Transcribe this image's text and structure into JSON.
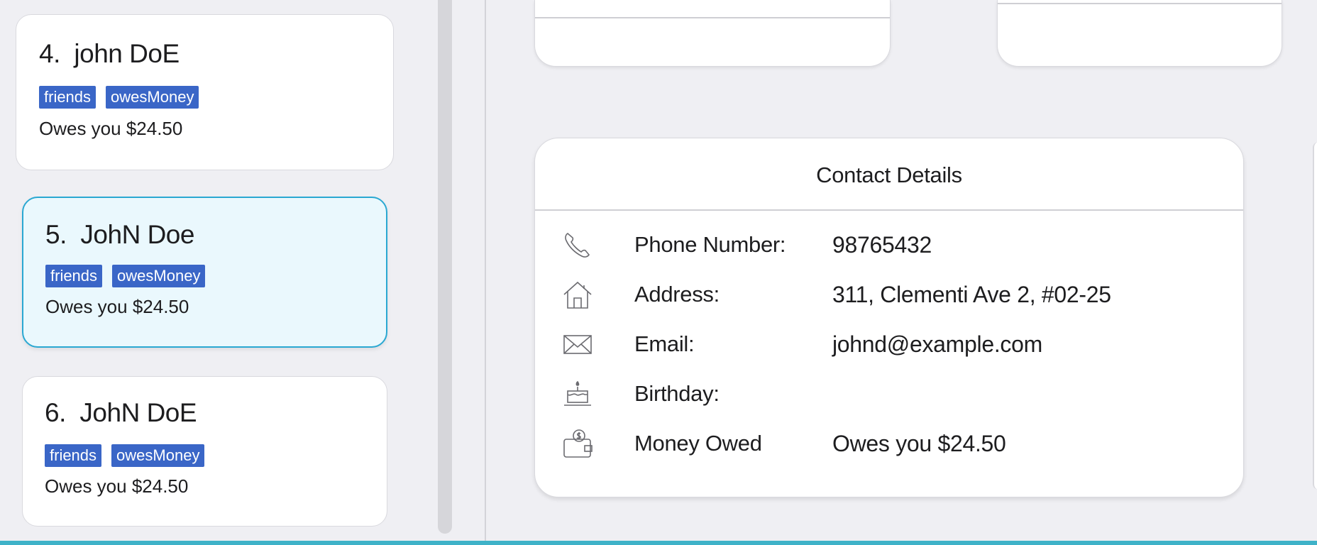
{
  "contacts": [
    {
      "index": "4.",
      "name": "john DoE",
      "tags": [
        "friends",
        "owesMoney"
      ],
      "owed": "Owes you $24.50"
    },
    {
      "index": "5.",
      "name": "JohN Doe",
      "tags": [
        "friends",
        "owesMoney"
      ],
      "owed": "Owes you $24.50"
    },
    {
      "index": "6.",
      "name": "JohN DoE",
      "tags": [
        "friends",
        "owesMoney"
      ],
      "owed": "Owes you $24.50"
    }
  ],
  "details": {
    "title": "Contact Details",
    "rows": [
      {
        "icon": "phone-icon",
        "label": "Phone Number:",
        "value": "98765432"
      },
      {
        "icon": "house-icon",
        "label": "Address:",
        "value": "311, Clementi Ave 2, #02-25"
      },
      {
        "icon": "envelope-icon",
        "label": "Email:",
        "value": "johnd@example.com"
      },
      {
        "icon": "cake-icon",
        "label": "Birthday:",
        "value": ""
      },
      {
        "icon": "wallet-icon",
        "label": "Money Owed",
        "value": "Owes you $24.50"
      }
    ]
  },
  "colors": {
    "background": "#efeff3",
    "tag": "#3a66c7",
    "selected_fill": "#eaf8fd",
    "selected_border": "#2aa8d2",
    "accent_bar": "#3fb2c8"
  }
}
